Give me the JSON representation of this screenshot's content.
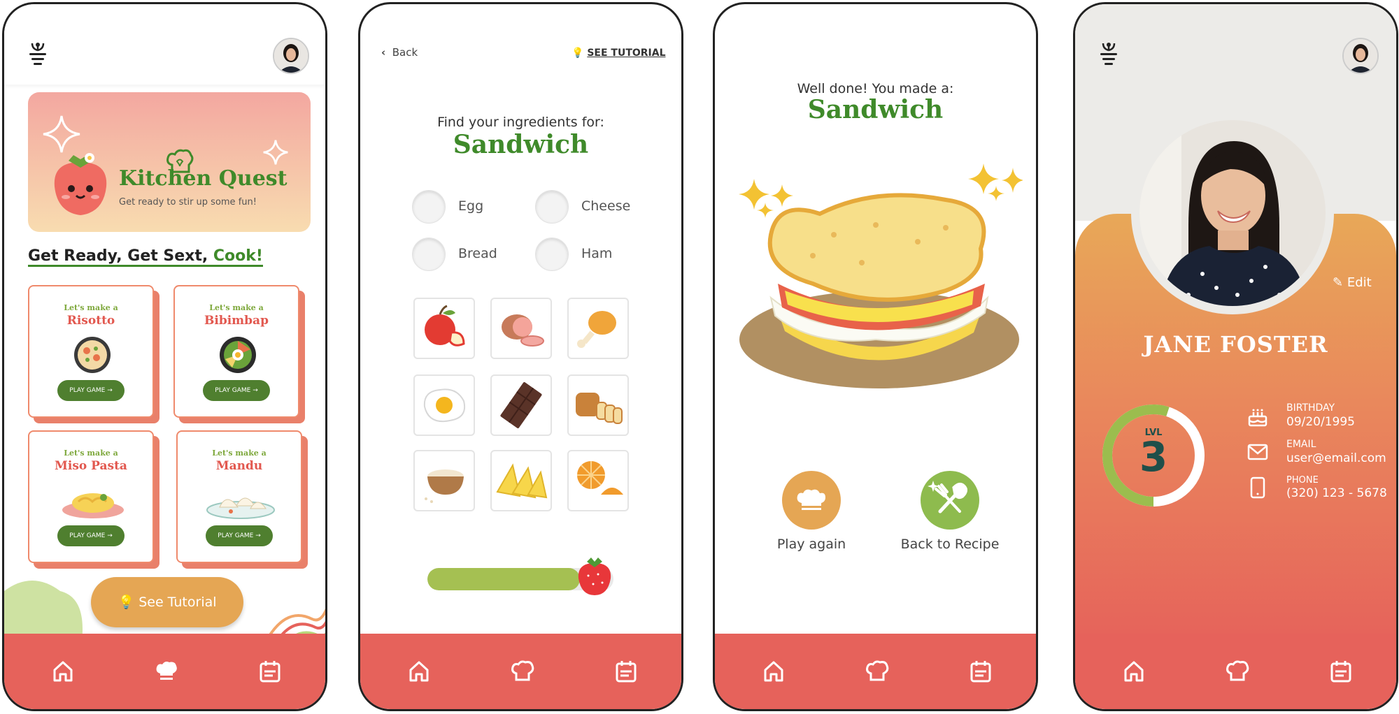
{
  "colors": {
    "accent_red": "#e6625b",
    "green_title": "#3f8a2a",
    "orange": "#e5a654",
    "dark_green": "#4f7f2f",
    "level_green": "#9bbd4e"
  },
  "screen_home": {
    "banner_title": "Kitchen Quest",
    "banner_subtitle": "Get ready to stir up some fun!",
    "heading_part1": "Get Ready, Get Sext, ",
    "heading_part2": "Cook!",
    "recipes": [
      {
        "prefix": "Let's make a",
        "name": "Risotto",
        "button": "PLAY GAME"
      },
      {
        "prefix": "Let's make a",
        "name": "Bibimbap",
        "button": "PLAY GAME"
      },
      {
        "prefix": "Let's make a",
        "name": "Miso Pasta",
        "button": "PLAY GAME"
      },
      {
        "prefix": "Let's make a",
        "name": "Mandu",
        "button": "PLAY GAME"
      }
    ],
    "tutorial_button": "See Tutorial"
  },
  "screen_game": {
    "back": "Back",
    "see_tutorial": "SEE TUTORIAL",
    "prompt": "Find your ingredients for:",
    "dish": "Sandwich",
    "ingredients": [
      "Egg",
      "Cheese",
      "Bread",
      "Ham"
    ],
    "tiles": [
      "apple-icon",
      "ham-icon",
      "chicken-leg-icon",
      "fried-egg-icon",
      "chocolate-icon",
      "bread-loaf-icon",
      "rice-bowl-icon",
      "cheese-icon",
      "orange-icon"
    ],
    "progress": 0.82
  },
  "screen_result": {
    "message": "Well done! You made a:",
    "dish": "Sandwich",
    "play_again": "Play again",
    "back_to_recipe": "Back to Recipe"
  },
  "screen_profile": {
    "edit": "Edit",
    "name": "JANE FOSTER",
    "level_label": "LVL",
    "level": "3",
    "level_progress": 0.55,
    "birthday_label": "BIRTHDAY",
    "birthday": "09/20/1995",
    "email_label": "EMAIL",
    "email": "user@email.com",
    "phone_label": "PHONE",
    "phone": "(320) 123 - 5678"
  },
  "nav": [
    "home-icon",
    "chef-hat-icon",
    "calendar-icon"
  ]
}
